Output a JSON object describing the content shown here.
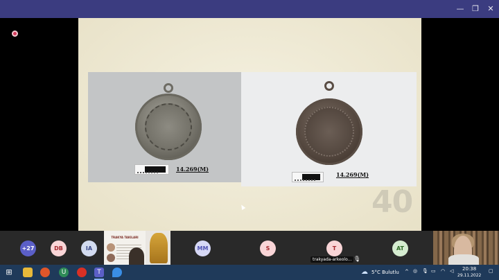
{
  "window": {
    "controls": {
      "minimize": "—",
      "restore": "❐",
      "close": "✕"
    }
  },
  "slide": {
    "left_label": "14.269(M)",
    "right_label": "14.269(M)",
    "page_number": "40"
  },
  "participants": [
    {
      "initials": "+27",
      "bg": "#5b5fc7",
      "fg": "#ffffff"
    },
    {
      "initials": "DB",
      "bg": "#f9d5d7",
      "fg": "#a4262c"
    },
    {
      "initials": "IA",
      "bg": "#d2dbf0",
      "fg": "#3b4a8a"
    },
    {
      "initials": "MM",
      "bg": "#d6d8f5",
      "fg": "#4f52b2"
    },
    {
      "initials": "S",
      "bg": "#f9d5d7",
      "fg": "#a4262c"
    },
    {
      "initials": "T",
      "bg": "#f9d5d7",
      "fg": "#a4262c"
    },
    {
      "initials": "AT",
      "bg": "#d5ecd0",
      "fg": "#2e6b26"
    }
  ],
  "presenter_tile": {
    "poster_title": "TRAKYA TAKILARI"
  },
  "screen_share": {
    "label": "trakyada-arkeolo..."
  },
  "taskbar": {
    "weather": "5°C Bulutlu",
    "time": "20:38",
    "date": "29.11.2022"
  }
}
